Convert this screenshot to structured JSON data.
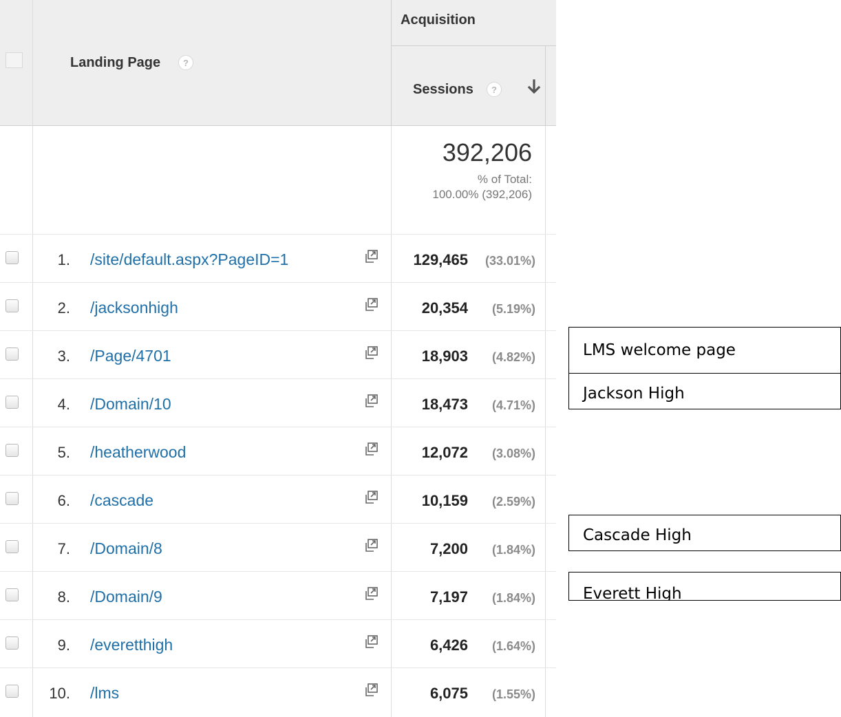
{
  "header": {
    "group_label": "Acquisition",
    "dimension_label": "Landing Page",
    "metric_label": "Sessions",
    "help_glyph": "?"
  },
  "totals": {
    "sessions": "392,206",
    "pct_label": "% of Total:",
    "pct_value": "100.00% (392,206)"
  },
  "rows": [
    {
      "rank": "1.",
      "page": "/site/default.aspx?PageID=1",
      "sessions": "129,465",
      "pct": "(33.01%)"
    },
    {
      "rank": "2.",
      "page": "/jacksonhigh",
      "sessions": "20,354",
      "pct": "(5.19%)"
    },
    {
      "rank": "3.",
      "page": "/Page/4701",
      "sessions": "18,903",
      "pct": "(4.82%)"
    },
    {
      "rank": "4.",
      "page": "/Domain/10",
      "sessions": "18,473",
      "pct": "(4.71%)"
    },
    {
      "rank": "5.",
      "page": "/heatherwood",
      "sessions": "12,072",
      "pct": "(3.08%)"
    },
    {
      "rank": "6.",
      "page": "/cascade",
      "sessions": "10,159",
      "pct": "(2.59%)"
    },
    {
      "rank": "7.",
      "page": "/Domain/8",
      "sessions": "7,200",
      "pct": "(1.84%)"
    },
    {
      "rank": "8.",
      "page": "/Domain/9",
      "sessions": "7,197",
      "pct": "(1.84%)"
    },
    {
      "rank": "9.",
      "page": "/everetthigh",
      "sessions": "6,426",
      "pct": "(1.64%)"
    },
    {
      "rank": "10.",
      "page": "/lms",
      "sessions": "6,075",
      "pct": "(1.55%)"
    }
  ],
  "annotations": [
    {
      "text": "LMS welcome page"
    },
    {
      "text": "Jackson High"
    },
    {
      "text": "Cascade High"
    },
    {
      "text": "Everett High"
    }
  ],
  "icons": {
    "help": "question-mark-circle",
    "sort": "arrow-down",
    "row_action": "open-in-new-window"
  }
}
